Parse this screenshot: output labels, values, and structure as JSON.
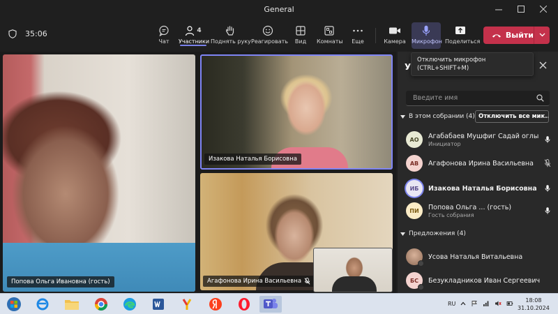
{
  "window": {
    "title": "General",
    "controls": [
      "minimize",
      "maximize",
      "close"
    ]
  },
  "toolbar": {
    "timer": "35:06",
    "participants_count": "4",
    "items": [
      {
        "key": "chat",
        "label": "Чат",
        "icon": "chat-icon"
      },
      {
        "key": "participants",
        "label": "Участники",
        "icon": "people-icon"
      },
      {
        "key": "raise_hand",
        "label": "Поднять руку",
        "icon": "hand-icon"
      },
      {
        "key": "react",
        "label": "Реагировать",
        "icon": "smile-icon"
      },
      {
        "key": "view",
        "label": "Вид",
        "icon": "grid-icon"
      },
      {
        "key": "rooms",
        "label": "Комнаты",
        "icon": "rooms-icon"
      },
      {
        "key": "more",
        "label": "Еще",
        "icon": "more-icon"
      },
      {
        "key": "camera",
        "label": "Камера",
        "icon": "camera-icon"
      },
      {
        "key": "mic",
        "label": "Микрофон",
        "icon": "mic-icon"
      },
      {
        "key": "share",
        "label": "Поделиться",
        "icon": "share-icon"
      }
    ],
    "leave_label": "Выйти"
  },
  "tooltip": {
    "line1": "Отключить микрофон",
    "line2": "(CTRL+SHIFT+M)"
  },
  "videos": {
    "main_name": "Попова Ольга Ивановна (гость)",
    "top_right_name": "Изакова Наталья Борисовна",
    "bottom_right_name": "Агафонова Ирина Васильевна"
  },
  "panel": {
    "title": "У",
    "search_placeholder": "Введите имя",
    "in_meeting_label": "В этом собрании (4)",
    "mute_all_label": "Отключить все мик...",
    "participants": [
      {
        "initials": "АО",
        "name": "Агабабаев Мушфиг Садай оглы",
        "role": "Инициатор",
        "avatar_color": "#e8ead4",
        "avatar_text": "#4a4a2a",
        "mic": "on",
        "bold": false
      },
      {
        "initials": "АВ",
        "name": "Агафонова Ирина Васильевна",
        "role": "",
        "avatar_color": "#f4d3cf",
        "avatar_text": "#7a2d25",
        "mic": "muted",
        "bold": false
      },
      {
        "initials": "ИБ",
        "name": "Изакова Наталья Борисовна",
        "role": "",
        "avatar_color": "#e9e6f3",
        "avatar_text": "#5b4d8c",
        "mic": "on",
        "bold": true
      },
      {
        "initials": "ПИ",
        "name": "Попова Ольга ... (гость)",
        "role": "Гость собрания",
        "avatar_color": "#fbecc6",
        "avatar_text": "#7a5a12",
        "mic": "on",
        "bold": false
      }
    ],
    "suggestions_label": "Предложения (4)",
    "suggestions": [
      {
        "initials": "",
        "name": "Усова Наталья Витальевна",
        "avatar_color": "#c7a48d",
        "avatar_text": "#333"
      },
      {
        "initials": "БС",
        "name": "Безукладников Иван Сергеевич",
        "avatar_color": "#f4d3cf",
        "avatar_text": "#7a2d25"
      }
    ]
  },
  "taskbar": {
    "apps": [
      "start-orb-icon",
      "edge-ie-icon",
      "explorer-icon",
      "chrome-icon",
      "edge-icon",
      "word-icon",
      "yandex-browser-icon",
      "yandex-icon",
      "opera-icon",
      "teams-icon"
    ],
    "language": "RU",
    "time": "18:08",
    "date": "31.10.2024"
  },
  "colors": {
    "accent": "#7b83eb",
    "leave": "#c4314b",
    "panel_bg": "#292929"
  }
}
